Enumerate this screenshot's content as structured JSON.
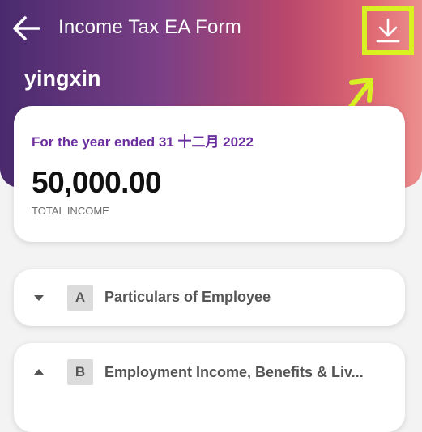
{
  "app_bar": {
    "title": "Income Tax EA Form",
    "back_icon": "arrow-left-icon",
    "download_icon": "download-icon"
  },
  "annotation": {
    "highlight_color": "#d9f022"
  },
  "user": {
    "name": "yingxin"
  },
  "summary": {
    "year_text": "For the year ended 31 十二月 2022",
    "amount": "50,000.00",
    "amount_label": "TOTAL INCOME"
  },
  "sections": [
    {
      "letter": "A",
      "title": "Particulars of Employee",
      "state": "collapsed",
      "caret_icon": "caret-down-icon"
    },
    {
      "letter": "B",
      "title": "Employment Income, Benefits & Liv...",
      "state": "expanded",
      "caret_icon": "caret-up-icon"
    }
  ],
  "colors": {
    "header_gradient": [
      "#4a2a6e",
      "#7a3f86",
      "#b9476c",
      "#df6a73",
      "#ec8f8f"
    ],
    "accent_purple": "#6b2fa0",
    "background": "#f3f3f3"
  }
}
